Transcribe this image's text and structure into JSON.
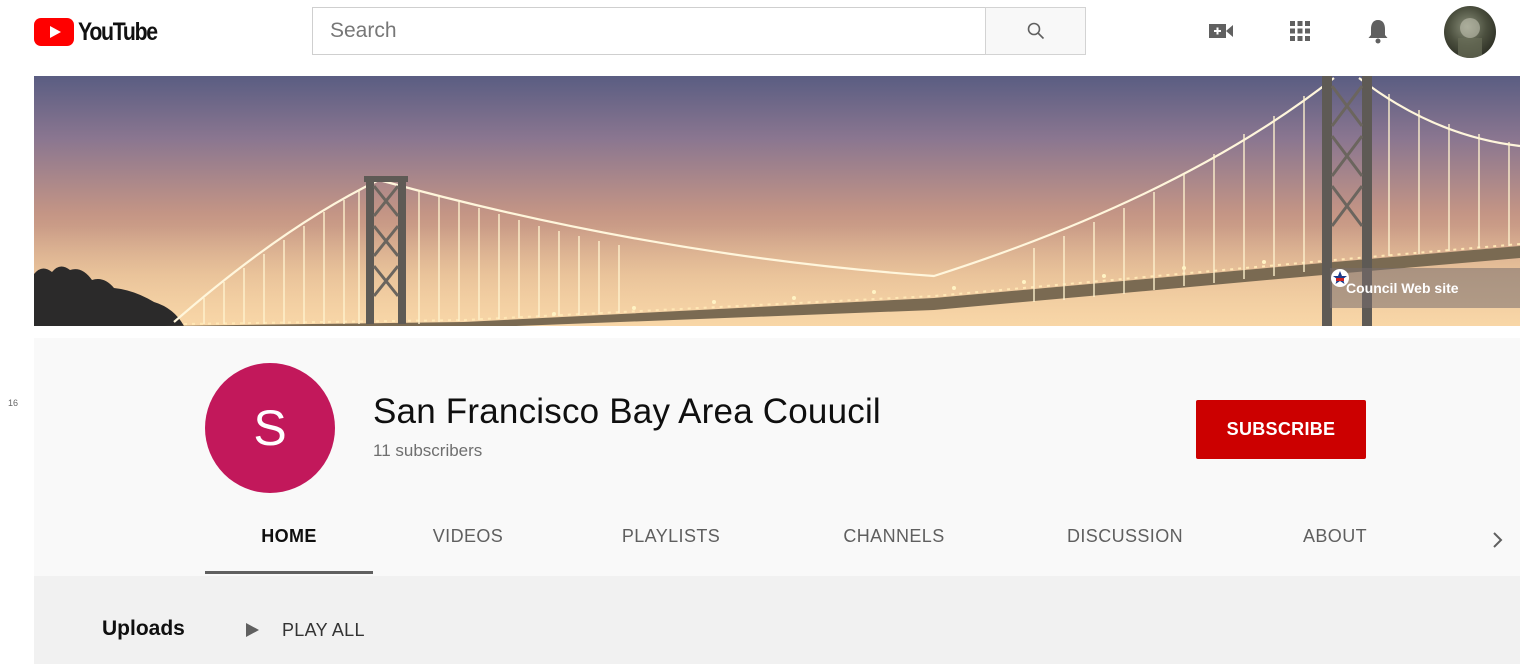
{
  "masthead": {
    "logo_text": "YouTube",
    "search_placeholder": "Search",
    "icons": [
      "video-camera-icon",
      "apps-grid-icon",
      "bell-icon"
    ]
  },
  "banner": {
    "link_label": "Council Web site"
  },
  "side_marker": "16",
  "channel": {
    "avatar_letter": "S",
    "avatar_color": "#c2185b",
    "name": "San Francisco Bay Area Couucil",
    "subscribers": "11 subscribers",
    "subscribe_label": "SUBSCRIBE",
    "subscribe_color": "#cc0000"
  },
  "tabs": [
    {
      "label": "HOME",
      "active": true
    },
    {
      "label": "VIDEOS",
      "active": false
    },
    {
      "label": "PLAYLISTS",
      "active": false
    },
    {
      "label": "CHANNELS",
      "active": false
    },
    {
      "label": "DISCUSSION",
      "active": false
    },
    {
      "label": "ABOUT",
      "active": false
    }
  ],
  "content": {
    "section_title": "Uploads",
    "play_all_label": "PLAY ALL"
  }
}
